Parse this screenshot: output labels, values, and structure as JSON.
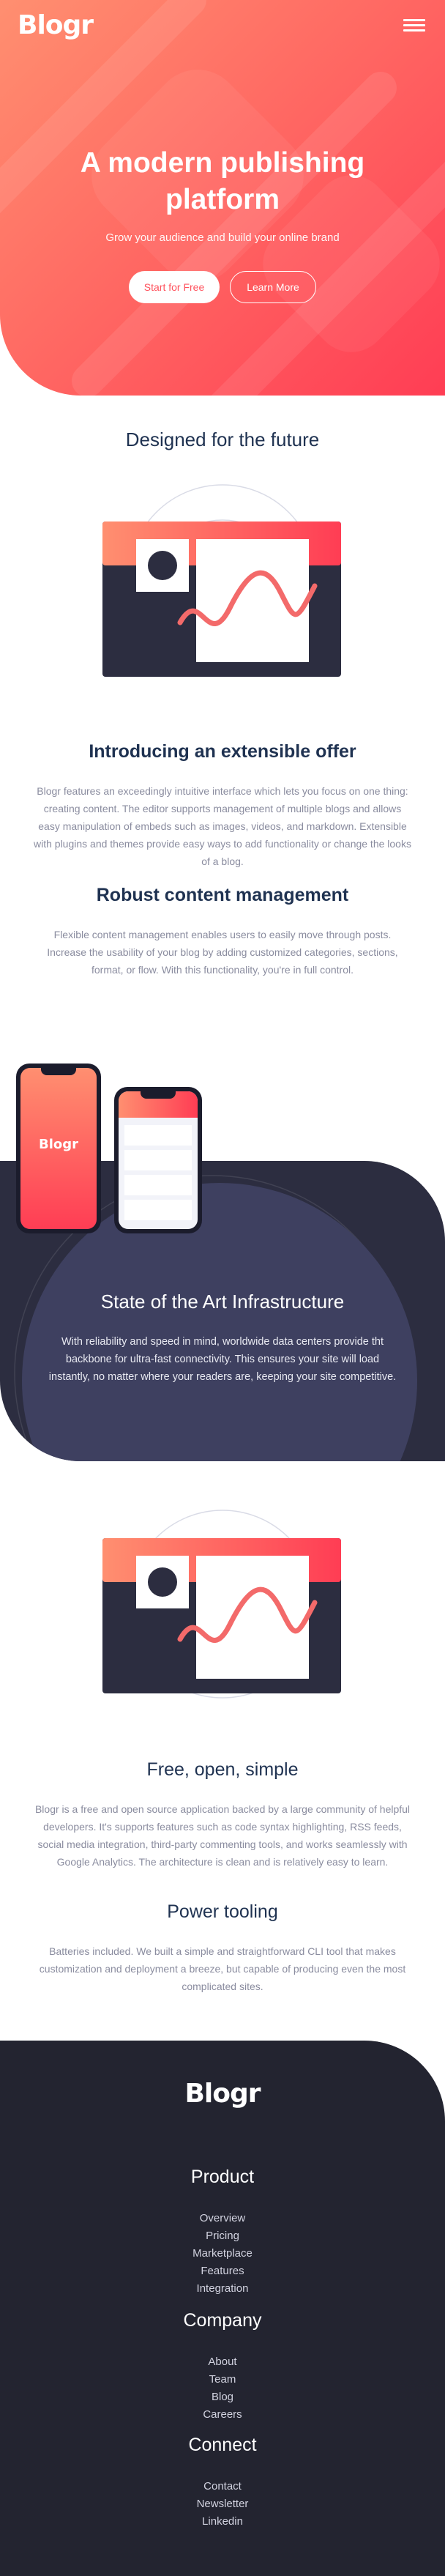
{
  "header": {
    "logo": "Blogr",
    "menu_icon": "hamburger-menu-icon"
  },
  "hero": {
    "title": "A modern publishing platform",
    "subtitle": "Grow your audience and build your online brand",
    "primary_button": "Start for Free",
    "secondary_button": "Learn More"
  },
  "future": {
    "title": "Designed for the future",
    "features": [
      {
        "title": "Introducing an extensible offer",
        "text": "Blogr features an exceedingly intuitive interface which lets you focus on one thing: creating content. The editor supports management of multiple blogs and allows easy manipulation of embeds such as images, videos, and markdown. Extensible with plugins and themes provide easy ways to add functionality or change the looks of a blog."
      },
      {
        "title": "Robust content management",
        "text": "Flexible content management enables users to easily move through posts. Increase the usability of your blog by adding customized categories, sections, format, or flow. With this functionality, you're in full control."
      }
    ]
  },
  "infrastructure": {
    "phone_logo": "Blogr",
    "title": "State of the Art Infrastructure",
    "text": "With reliability and speed in mind, worldwide data centers provide tht backbone for ultra-fast connectivity. This ensures your site will load instantly, no matter where your readers are, keeping your site competitive."
  },
  "open": {
    "features": [
      {
        "title": "Free, open, simple",
        "text": "Blogr is a free and open source application backed by a large community of helpful developers. It's supports features such as code syntax highlighting, RSS feeds, social media integration, third-party commenting tools, and works seamlessly with Google Analytics. The architecture is clean and is relatively easy to learn."
      },
      {
        "title": "Power tooling",
        "text": "Batteries included. We built a simple and straightforward CLI tool that makes customization and deployment a breeze, but capable of producing even the most complicated sites."
      }
    ]
  },
  "footer": {
    "logo": "Blogr",
    "columns": [
      {
        "heading": "Product",
        "links": [
          "Overview",
          "Pricing",
          "Marketplace",
          "Features",
          "Integration"
        ]
      },
      {
        "heading": "Company",
        "links": [
          "About",
          "Team",
          "Blog",
          "Careers"
        ]
      },
      {
        "heading": "Connect",
        "links": [
          "Contact",
          "Newsletter",
          "Linkedin"
        ]
      }
    ]
  },
  "colors": {
    "brand_gradient_start": "#ff8f70",
    "brand_gradient_end": "#ff3d54",
    "dark_navy": "#1f3251",
    "dark_section": "#2c2d40",
    "footer_bg": "#232430",
    "body_text": "#8a8c9f"
  }
}
